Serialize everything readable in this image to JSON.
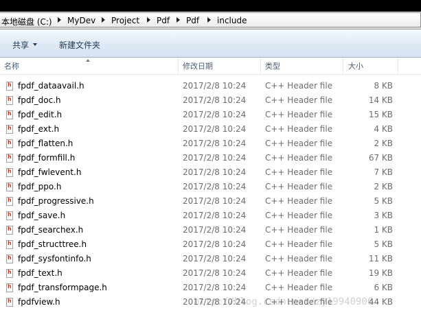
{
  "address": {
    "segments": [
      "本地磁盘 (C:)",
      "MyDev",
      "Project",
      "Pdf",
      "Pdf",
      "include"
    ]
  },
  "toolbar": {
    "share_label": "共享",
    "new_folder_label": "新建文件夹"
  },
  "columns": {
    "name": "名称",
    "modified": "修改日期",
    "type": "类型",
    "size": "大小"
  },
  "files": [
    {
      "name": "fpdf_dataavail.h",
      "modified": "2017/2/8 10:24",
      "type": "C++ Header file",
      "size": "8 KB"
    },
    {
      "name": "fpdf_doc.h",
      "modified": "2017/2/8 10:24",
      "type": "C++ Header file",
      "size": "14 KB"
    },
    {
      "name": "fpdf_edit.h",
      "modified": "2017/2/8 10:24",
      "type": "C++ Header file",
      "size": "15 KB"
    },
    {
      "name": "fpdf_ext.h",
      "modified": "2017/2/8 10:24",
      "type": "C++ Header file",
      "size": "4 KB"
    },
    {
      "name": "fpdf_flatten.h",
      "modified": "2017/2/8 10:24",
      "type": "C++ Header file",
      "size": "2 KB"
    },
    {
      "name": "fpdf_formfill.h",
      "modified": "2017/2/8 10:24",
      "type": "C++ Header file",
      "size": "67 KB"
    },
    {
      "name": "fpdf_fwlevent.h",
      "modified": "2017/2/8 10:24",
      "type": "C++ Header file",
      "size": "7 KB"
    },
    {
      "name": "fpdf_ppo.h",
      "modified": "2017/2/8 10:24",
      "type": "C++ Header file",
      "size": "2 KB"
    },
    {
      "name": "fpdf_progressive.h",
      "modified": "2017/2/8 10:24",
      "type": "C++ Header file",
      "size": "5 KB"
    },
    {
      "name": "fpdf_save.h",
      "modified": "2017/2/8 10:24",
      "type": "C++ Header file",
      "size": "3 KB"
    },
    {
      "name": "fpdf_searchex.h",
      "modified": "2017/2/8 10:24",
      "type": "C++ Header file",
      "size": "1 KB"
    },
    {
      "name": "fpdf_structtree.h",
      "modified": "2017/2/8 10:24",
      "type": "C++ Header file",
      "size": "5 KB"
    },
    {
      "name": "fpdf_sysfontinfo.h",
      "modified": "2017/2/8 10:24",
      "type": "C++ Header file",
      "size": "11 KB"
    },
    {
      "name": "fpdf_text.h",
      "modified": "2017/2/8 10:24",
      "type": "C++ Header file",
      "size": "19 KB"
    },
    {
      "name": "fpdf_transformpage.h",
      "modified": "2017/2/8 10:24",
      "type": "C++ Header file",
      "size": "6 KB"
    },
    {
      "name": "fpdfview.h",
      "modified": "2017/2/8 10:24",
      "type": "C++ Header file",
      "size": "44 KB"
    }
  ],
  "watermark": "http://blog.csdn.net/zy19940906"
}
